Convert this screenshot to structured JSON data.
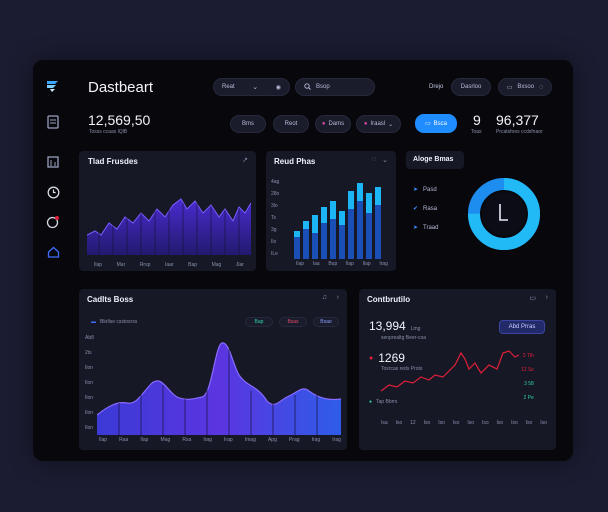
{
  "header": {
    "title": "Dastbeart",
    "stat_value": "12,569,50",
    "stat_caption": "Tosss ccaas lQlB",
    "select_label": "Reat",
    "search_placeholder": "Bsop",
    "user_name": "Drejo",
    "pill_label": "Dasrloo",
    "icon_pill_label": "Bxsoo"
  },
  "toolbar": {
    "chips": [
      "Bms",
      "Reot",
      "Dams",
      "Iraasl"
    ],
    "action_label": "Bsca",
    "kpi_left": "9",
    "kpi_value": "96,377",
    "kpi_caption_a": "Toas",
    "kpi_caption_b": "Prcatsfoes ccdsfnaor"
  },
  "sidebar": {
    "items": [
      {
        "name": "logo-icon"
      },
      {
        "name": "document-icon"
      },
      {
        "name": "chart-icon"
      },
      {
        "name": "clock-icon"
      },
      {
        "name": "analytics-icon"
      },
      {
        "name": "home-icon"
      }
    ]
  },
  "panels": {
    "trend": {
      "title": "Tlad Frusdes",
      "x_labels": [
        "Ilap",
        "Mar",
        "Rrsp",
        "Iaar",
        "Bap",
        "Mag",
        "Jlar"
      ]
    },
    "bars": {
      "title": "Reud Phas",
      "y_labels": [
        "4ag",
        "28o",
        "3lo",
        "Ts",
        "3g",
        "Ilo",
        "ILe"
      ],
      "x_labels": [
        "Ilap",
        "Iaa",
        "Bup",
        "Ilap",
        "Ilap",
        "Irag"
      ]
    },
    "donut": {
      "title": "Aloge Bmas",
      "legend": [
        "Pasd",
        "Rasa",
        "Traad"
      ],
      "progress_fraction": 0.75
    },
    "area": {
      "title": "Cadlts Boss",
      "legend_label": "Bkrllse csstosrss",
      "tags": [
        "Bap",
        "Bsas",
        "Bsao"
      ],
      "y_labels": [
        "Ab8",
        "2ts",
        "Ilon",
        "Ilon",
        "Ilon",
        "Ilon",
        "Ilon"
      ],
      "x_labels": [
        "Ilap",
        "Raa",
        "Ilap",
        "Mag",
        "Rsa",
        "Irag",
        "Irap",
        "Imag",
        "Apg",
        "Prag",
        "Irag",
        "Irag"
      ]
    },
    "comparison": {
      "title": "Contbrutilo",
      "value_a": "13,994",
      "unit_a": "Lmg",
      "caption_a": "senprealtg Beer-coa",
      "button_label": "Abd Prras",
      "value_b": "1269",
      "caption_b": "Tosrcas reds Prots",
      "legend_label": "Tap Bbrrs",
      "right_values": [
        "3 Tlh",
        "12 Ss",
        "3 58",
        "2 Pe"
      ],
      "x_labels": [
        "Isa",
        "Iso",
        "12",
        "Iso",
        "Iso",
        "Iso",
        "Iso",
        "Iso",
        "Iso",
        "Iso",
        "Iso",
        "Iso"
      ]
    }
  },
  "colors": {
    "background": "#1b1c31",
    "app": "#07070c",
    "panel": "#161826",
    "accent_blue": "#1f8cff",
    "purple": "#5b35e0",
    "cyan": "#1cb6f5",
    "red": "#e0203a"
  }
}
